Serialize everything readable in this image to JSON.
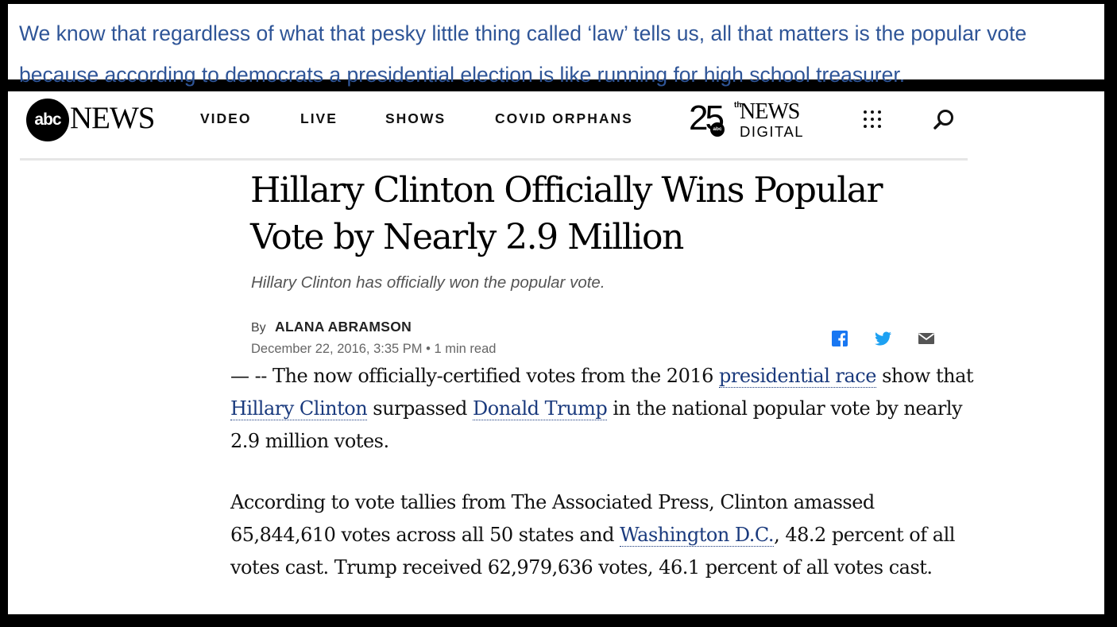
{
  "caption": {
    "text": "We know that regardless of what that pesky little thing called ‘law’ tells us, all that matters is the popular vote because according to democrats a presidential election is like running for high school treasurer."
  },
  "nav": {
    "logo_abc": "abc",
    "logo_news": "NEWS",
    "items": [
      "VIDEO",
      "LIVE",
      "SHOWS",
      "COVID ORPHANS"
    ],
    "anniversary": {
      "number": "25",
      "suffix": "th",
      "abc": "abc",
      "news": "NEWS",
      "digital": "DIGITAL"
    },
    "icons": [
      "grid-menu-icon",
      "search-icon"
    ]
  },
  "article": {
    "headline": "Hillary Clinton Officially Wins Popular Vote by Nearly 2.9 Million",
    "subhead": "Hillary Clinton has officially won the popular vote.",
    "by_label": "By",
    "author": "ALANA ABRAMSON",
    "dateline": "December 22, 2016, 3:35 PM • 1 min read",
    "share_icons": [
      "facebook-icon",
      "twitter-icon",
      "email-icon"
    ],
    "colors": {
      "facebook": "#1877f2",
      "twitter": "#1da1f2",
      "email": "#555555",
      "link": "#1a3a7d"
    },
    "p1": {
      "t1": "— -- The now officially-certified votes from the 2016 ",
      "link1": "presidential race",
      "t2": " show that ",
      "link2": "Hillary Clinton",
      "t3": " surpassed ",
      "link3": "Donald Trump",
      "t4": " in the national popular vote by nearly 2.9 million votes."
    },
    "p2": {
      "t1": "According to vote tallies from The Associated Press, Clinton amassed 65,844,610 votes across all 50 states and ",
      "link1": "Washington D.C.",
      "t2": ", 48.2 percent of all votes cast. Trump received 62,979,636 votes, 46.1 percent of all votes cast."
    }
  }
}
